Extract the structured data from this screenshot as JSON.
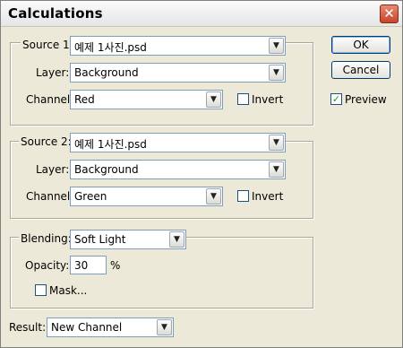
{
  "window": {
    "title": "Calculations",
    "close_glyph": "✕"
  },
  "source1": {
    "label": "Source 1:",
    "file": "예제 1사진.psd",
    "layer_label": "Layer:",
    "layer": "Background",
    "channel_label": "Channel:",
    "channel": "Red",
    "invert_label": "Invert",
    "invert_checked": false
  },
  "source2": {
    "label": "Source 2:",
    "file": "예제 1사진.psd",
    "layer_label": "Layer:",
    "layer": "Background",
    "channel_label": "Channel:",
    "channel": "Green",
    "invert_label": "Invert",
    "invert_checked": false
  },
  "blending": {
    "label": "Blending:",
    "mode": "Soft Light",
    "opacity_label": "Opacity:",
    "opacity": "30",
    "opacity_unit": "%",
    "mask_label": "Mask...",
    "mask_checked": false
  },
  "result": {
    "label": "Result:",
    "value": "New Channel"
  },
  "buttons": {
    "ok": "OK",
    "cancel": "Cancel"
  },
  "preview": {
    "label": "Preview",
    "checked": true,
    "check_glyph": "✓"
  },
  "icons": {
    "dropdown_arrow": "chevron-down-icon"
  }
}
